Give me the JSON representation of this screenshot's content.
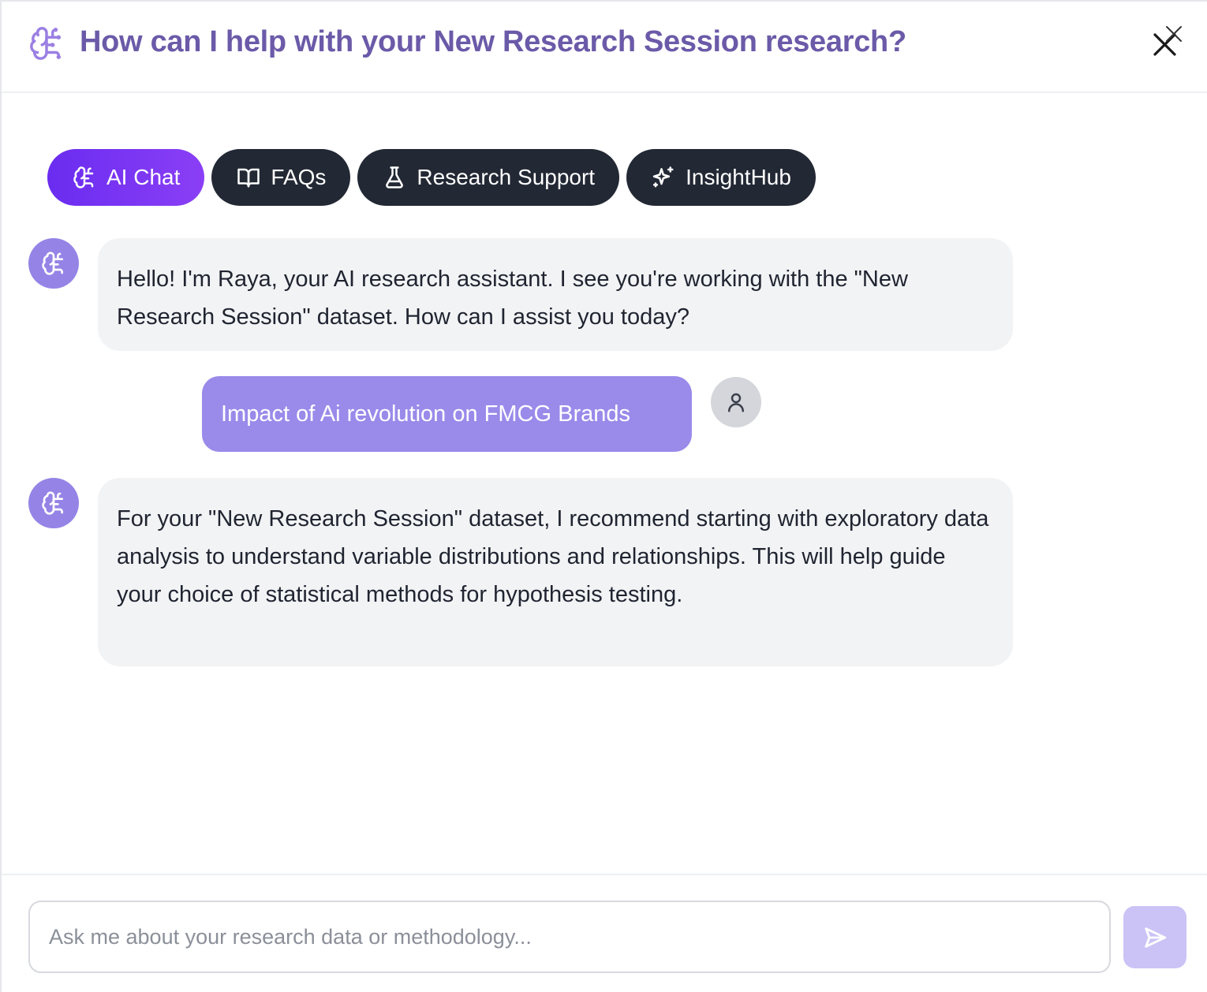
{
  "header": {
    "title": "How can I help with your New Research Session research?",
    "icon": "brain-circuit-icon",
    "close_icon": "close-icon"
  },
  "tabs": [
    {
      "label": "AI Chat",
      "icon": "brain-circuit-icon",
      "active": true
    },
    {
      "label": "FAQs",
      "icon": "book-open-icon",
      "active": false
    },
    {
      "label": "Research Support",
      "icon": "flask-icon",
      "active": false
    },
    {
      "label": "InsightHub",
      "icon": "sparkles-icon",
      "active": false
    }
  ],
  "messages": [
    {
      "role": "assistant",
      "text": "Hello! I'm Raya, your AI research assistant. I see you're working with the \"New Research Session\" dataset. How can I assist you today?"
    },
    {
      "role": "user",
      "text": "Impact of Ai revolution on FMCG Brands"
    },
    {
      "role": "assistant",
      "text": "For your \"New Research Session\" dataset, I recommend starting with exploratory data analysis to understand variable distributions and relationships. This will help guide your choice of statistical methods for hypothesis testing."
    }
  ],
  "composer": {
    "placeholder": "Ask me about your research data or methodology...",
    "value": "",
    "send_icon": "send-icon"
  },
  "colors": {
    "title": "#6b5aa8",
    "tab_active": "#7a33f2",
    "tab_inactive": "#222834",
    "bot_avatar": "#9584e6",
    "user_bubble": "#9a8aea",
    "bot_bubble": "#f2f3f5",
    "send_button": "#cbc3f6"
  }
}
